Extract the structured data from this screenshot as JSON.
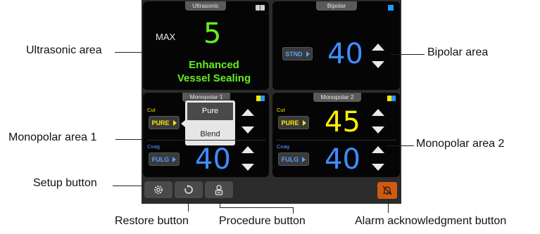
{
  "ultrasonic": {
    "tab": "Ultrasonic",
    "max_label": "MAX",
    "level": "5",
    "mode_line1": "Enhanced",
    "mode_line2": "Vessel Sealing"
  },
  "bipolar": {
    "tab": "Bipolar",
    "mode_button": "STND",
    "value": "40"
  },
  "monopolar1": {
    "tab": "Monopolar 1",
    "cut_label": "Cut",
    "cut_button": "PURE",
    "coag_label": "Coag",
    "coag_button": "FULG",
    "coag_value": "40",
    "dropdown": [
      "Pure",
      "Blend"
    ]
  },
  "monopolar2": {
    "tab": "Monopolar 2",
    "cut_label": "Cut",
    "cut_button": "PURE",
    "cut_value": "45",
    "coag_label": "Coag",
    "coag_button": "FULG",
    "coag_value": "40"
  },
  "callouts": {
    "ultrasonic_area": "Ultrasonic area",
    "bipolar_area": "Bipolar area",
    "monopolar_area_1": "Monopolar area 1",
    "monopolar_area_2": "Monopolar area 2",
    "setup_button": "Setup button",
    "restore_button": "Restore button",
    "procedure_button": "Procedure button",
    "alarm_ack_button": "Alarm acknowledgment button"
  },
  "colors": {
    "green": "#66ee22",
    "blue": "#3f8cff",
    "yellow": "#ffee00",
    "alarm": "#d05a10"
  }
}
